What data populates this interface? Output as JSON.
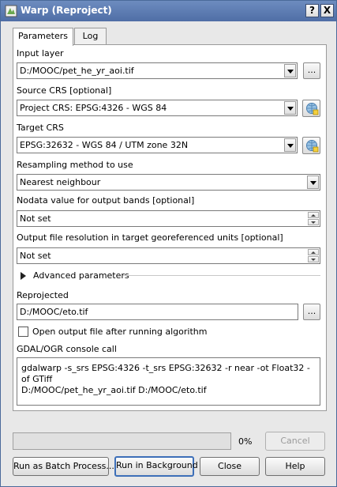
{
  "window": {
    "title": "Warp (Reproject)",
    "help_label": "?",
    "close_label": "X"
  },
  "tabs": [
    {
      "label": "Parameters",
      "active": true
    },
    {
      "label": "Log",
      "active": false
    }
  ],
  "fields": {
    "input_layer": {
      "label": "Input layer",
      "value": "D:/MOOC/pet_he_yr_aoi.tif",
      "browse_label": "..."
    },
    "source_crs": {
      "label": "Source CRS [optional]",
      "value": "Project CRS: EPSG:4326 - WGS 84"
    },
    "target_crs": {
      "label": "Target CRS",
      "value": "EPSG:32632 - WGS 84 / UTM zone 32N"
    },
    "resampling": {
      "label": "Resampling method to use",
      "value": "Nearest neighbour"
    },
    "nodata": {
      "label": "Nodata value for output bands [optional]",
      "value": "Not set"
    },
    "resolution": {
      "label": "Output file resolution in target georeferenced units [optional]",
      "value": "Not set"
    },
    "advanced": {
      "label": "Advanced parameters"
    },
    "reprojected": {
      "label": "Reprojected",
      "value": "D:/MOOC/eto.tif",
      "browse_label": "..."
    },
    "open_output": {
      "label": "Open output file after running algorithm",
      "checked": false
    },
    "console": {
      "label": "GDAL/OGR console call",
      "line1": "gdalwarp -s_srs EPSG:4326 -t_srs EPSG:32632 -r near -ot Float32 -of GTiff",
      "line2": "D:/MOOC/pet_he_yr_aoi.tif D:/MOOC/eto.tif"
    }
  },
  "progress": {
    "value": 0,
    "text": "0%"
  },
  "buttons": {
    "cancel": "Cancel",
    "batch": "Run as Batch Process...",
    "background": "Run in Background",
    "close": "Close",
    "help": "Help"
  },
  "icons": {
    "app": "qgis-warp-icon",
    "crs": "crs-selector-icon"
  },
  "colors": {
    "titlebar": "#5a79b0",
    "progress_fill": "#3a8ee6"
  }
}
